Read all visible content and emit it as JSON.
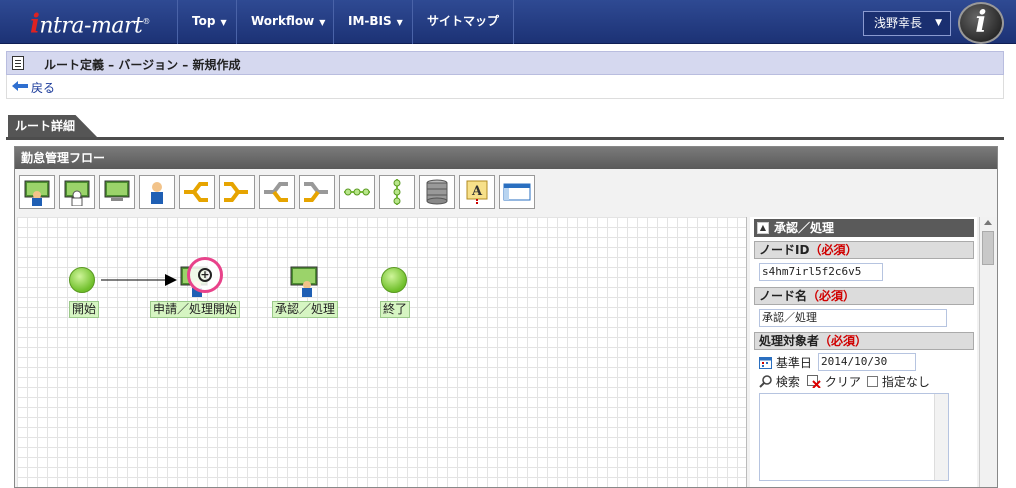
{
  "nav": {
    "logo": "intra-mart",
    "items": [
      {
        "label": "Top"
      },
      {
        "label": "Workflow"
      },
      {
        "label": "IM-BIS"
      },
      {
        "label": "サイトマップ"
      }
    ],
    "user": "浅野幸長"
  },
  "page": {
    "title": "ルート定義 – バージョン – 新規作成",
    "back_label": "戻る",
    "tab_label": "ルート詳細",
    "panel_title": "勤怠管理フロー"
  },
  "toolbar": {
    "tools": [
      "start-node",
      "apply-node",
      "approve-node",
      "user-node",
      "branch-node",
      "join-node",
      "split-node",
      "merge-node",
      "path-node",
      "vertical-path-node",
      "db-node",
      "text-node",
      "window-node"
    ]
  },
  "flow": {
    "nodes": [
      {
        "label": "開始"
      },
      {
        "label": "申請／処理開始"
      },
      {
        "label": "承認／処理"
      },
      {
        "label": "終了"
      }
    ]
  },
  "props": {
    "section_title": "承認／処理",
    "node_id_label": "ノードID",
    "required": "（必須）",
    "node_id_value": "s4hm7irl5f2c6v5",
    "node_name_label": "ノード名",
    "node_name_value": "承認／処理",
    "target_label": "処理対象者",
    "base_date_label": "基準日",
    "base_date_value": "2014/10/30",
    "search_label": "検索",
    "clear_label": "クリア",
    "none_label": "指定なし"
  },
  "colors": {
    "nav_bg": "#1c3275",
    "title_bar": "#d5d8ef",
    "node_label_bg": "#d6f5c2",
    "required": "#d00000",
    "highlight_ring": "#e8428a"
  }
}
